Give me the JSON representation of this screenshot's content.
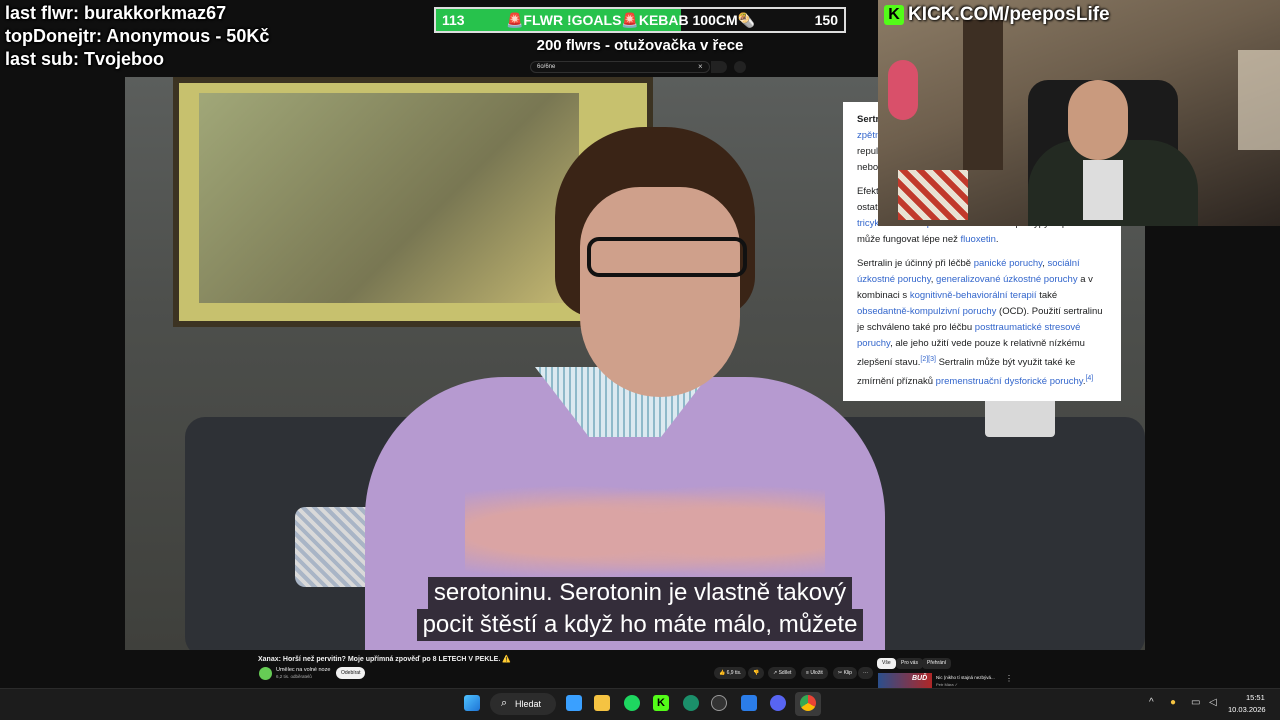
{
  "overlay": {
    "last_follower": "last flwr: burakkorkmaz67",
    "top_donator": "topDonejtr: Anonymous - 50Kč",
    "last_sub": "last sub: Tvojeboo"
  },
  "goal": {
    "start": "113",
    "end": "150",
    "label": "🚨FLWR !GOALS🚨KEBAB 100CM🌯",
    "subtitle": "200 flwrs - otužovačka v řece",
    "progress_fraction": 0.6,
    "fill_color": "#27c24c"
  },
  "kick": {
    "logo": "K",
    "text": "KICK.COM/peeposLife",
    "color": "#53fc18"
  },
  "browser": {
    "search_value": "6o/6ne",
    "clear_icon": "×"
  },
  "subtitles": [
    "serotoninu. Serotonin je vlastně takový",
    "pocit štěstí a když ho máte málo, můžete"
  ],
  "wiki": {
    "p1_bold": "Sertr",
    "p1_link": "zpětn",
    "p1_text": "repul",
    "p1_text2": "nebo",
    "p2_text": "Efekt",
    "p2_text2": "ostat",
    "p2_link": "tricyklická antidepresiva",
    "p2_rest": " a na některé podtypy deprese může fungovat lépe než ",
    "p2_link2": "fluoxetin",
    "p2_end": ".",
    "p3_t1": "Sertralin je účinný při léčbě ",
    "p3_l1": "panické poruchy",
    "p3_t2": ", ",
    "p3_l2": "sociální úzkostné poruchy",
    "p3_t3": ", ",
    "p3_l3": "generalizované úzkostné poruchy",
    "p3_t4": " a v kombinaci s ",
    "p3_l4": "kognitivně-behaviorální terapií",
    "p3_t5": " také ",
    "p3_l5": "obsedantně-kompulzivní poruchy",
    "p3_t6": " (OCD). Použití sertralinu je schváleno také pro léčbu ",
    "p3_l6": "posttraumatické stresové poruchy",
    "p3_t7": ", ale jeho užití vede pouze k relativně nízkému zlepšení stavu.",
    "p3_ref1": "[2][3]",
    "p3_t8": " Sertralin může být využit také ke zmírnění příznaků ",
    "p3_l7": "premenstruační dysforické poruchy",
    "p3_t9": ".",
    "p3_ref2": "[4]"
  },
  "youtube": {
    "video_title": "Xanax: Horší než pervitin? Moje upřímná zpověď po 8 LETECH V PEKLE. ⚠️",
    "channel_name": "Umělec na volné noze",
    "channel_subs": "6,2 tis. odběratelů",
    "subscribe_label": "Odebírat",
    "like_count": "6,9 tis.",
    "share_label": "Sdílet",
    "save_label": "Uložit",
    "clip_label": "Klip",
    "more_label": "···",
    "chips": [
      "Vše",
      "Pro vás",
      "Přehrání"
    ],
    "rec_thumb_text": "BUĎ",
    "rec_title": "Nic (nikho tí stajná nezbývá...",
    "rec_channel": "Petr Mára ✓",
    "rec_more": "⋮"
  },
  "taskbar": {
    "search_label": "Hledat",
    "time": "15:51",
    "date": "10.03.2026",
    "apps": [
      "windows-start",
      "search",
      "notepad",
      "file-explorer",
      "spotify",
      "kick",
      "edge",
      "obs",
      "photos",
      "discord",
      "chrome"
    ]
  }
}
